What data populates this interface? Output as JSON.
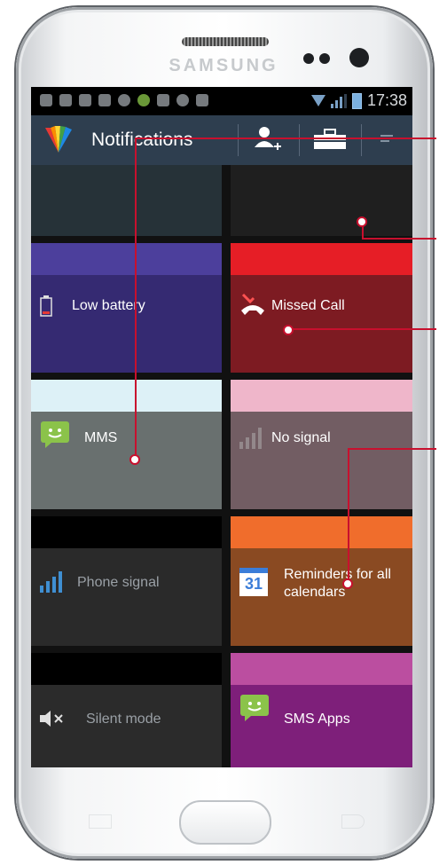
{
  "device": {
    "brand": "SAMSUNG"
  },
  "statusbar": {
    "time": "17:38"
  },
  "actionbar": {
    "title": "Notifications",
    "add_user_icon": "add-user-icon",
    "toolbox_icon": "toolbox-icon",
    "menu_icon": "menu-icon"
  },
  "tiles": {
    "low_battery": {
      "label": "Low battery",
      "header_color": "#4c3f9c",
      "body_color": "#352a72"
    },
    "missed_call": {
      "label": "Missed Call",
      "header_color": "#e61e26",
      "body_color": "#7d1b22"
    },
    "mms": {
      "label": "MMS",
      "header_color": "#ddf1f7",
      "body_color": "#69706f"
    },
    "no_signal": {
      "label": "No signal",
      "header_color": "#efb6ca",
      "body_color": "#725d63"
    },
    "phone_signal": {
      "label": "Phone signal",
      "header_color": "#000000",
      "body_color": "#2a2a2a"
    },
    "reminders": {
      "label": "Reminders for all calendars",
      "header_color": "#f06d2c",
      "body_color": "#8a4a22",
      "calendar_day": "31"
    },
    "silent_mode": {
      "label": "Silent mode",
      "header_color": "#000000",
      "body_color": "#2b2b2b"
    },
    "sms_apps": {
      "label": "SMS Apps",
      "header_color": "#bb4ea0",
      "body_color": "#7e1f7a"
    }
  },
  "accent": "#c8102e"
}
